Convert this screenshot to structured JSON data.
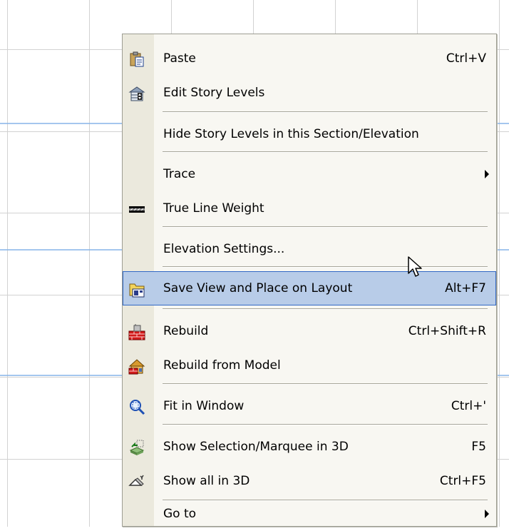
{
  "context_menu": {
    "items": [
      {
        "label": "Paste",
        "shortcut": "Ctrl+V",
        "icon": "paste-icon"
      },
      {
        "label": "Edit Story Levels",
        "shortcut": "",
        "icon": "story-levels-icon"
      },
      {
        "label": "Hide Story Levels in this Section/Elevation",
        "shortcut": "",
        "icon": ""
      },
      {
        "label": "Trace",
        "shortcut": "",
        "icon": "",
        "submenu": true
      },
      {
        "label": "True Line Weight",
        "shortcut": "",
        "icon": "true-line-weight-icon"
      },
      {
        "label": "Elevation Settings...",
        "shortcut": "",
        "icon": ""
      },
      {
        "label": "Save View and Place on Layout",
        "shortcut": "Alt+F7",
        "icon": "save-view-layout-icon",
        "selected": true
      },
      {
        "label": "Rebuild",
        "shortcut": "Ctrl+Shift+R",
        "icon": "rebuild-icon"
      },
      {
        "label": "Rebuild from Model",
        "shortcut": "",
        "icon": "rebuild-from-model-icon"
      },
      {
        "label": "Fit in Window",
        "shortcut": "Ctrl+'",
        "icon": "fit-in-window-icon"
      },
      {
        "label": "Show Selection/Marquee in 3D",
        "shortcut": "F5",
        "icon": "show-selection-3d-icon"
      },
      {
        "label": "Show all in 3D",
        "shortcut": "Ctrl+F5",
        "icon": "show-all-3d-icon"
      },
      {
        "label": "Go to",
        "shortcut": "",
        "icon": "",
        "submenu": true
      }
    ]
  },
  "colors": {
    "highlight_fill": "#b8cce8",
    "highlight_border": "#3168c5",
    "menu_background": "#f8f7f2",
    "icon_column": "#ebe9dd",
    "grid_gray": "#cfcfcf",
    "grid_blue": "#86b3e8"
  }
}
